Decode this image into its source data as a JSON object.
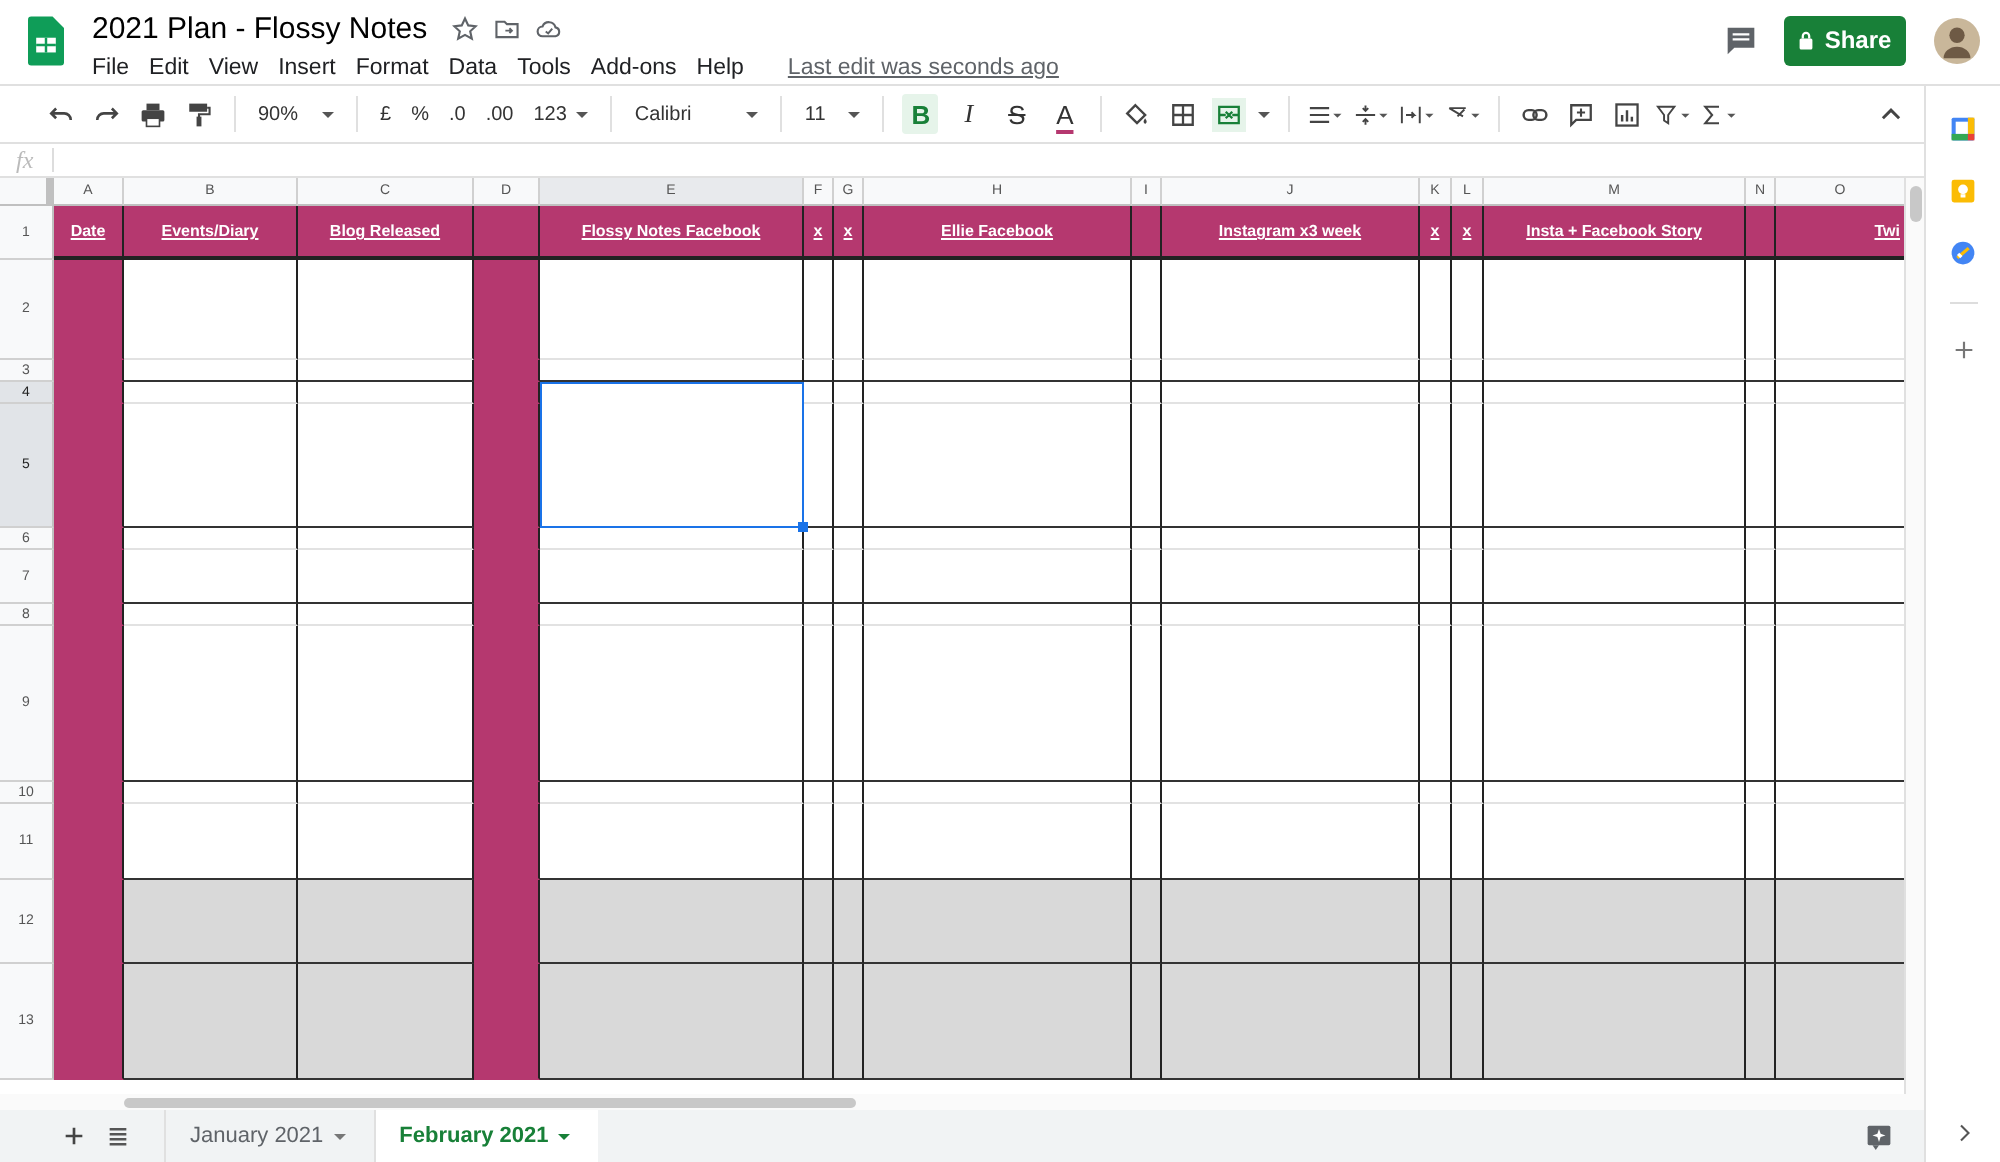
{
  "document": {
    "title": "2021 Plan - Flossy Notes"
  },
  "menu": [
    {
      "label": "File"
    },
    {
      "label": "Edit"
    },
    {
      "label": "View"
    },
    {
      "label": "Insert"
    },
    {
      "label": "Format"
    },
    {
      "label": "Data"
    },
    {
      "label": "Tools"
    },
    {
      "label": "Add-ons"
    },
    {
      "label": "Help"
    }
  ],
  "last_edit": "Last edit was seconds ago",
  "share_button": "Share",
  "toolbar": {
    "zoom": "90%",
    "currency": "£",
    "percent": "%",
    "decrease_decimals": ".0",
    "increase_decimals": ".00",
    "number_format": "123",
    "font": "Calibri",
    "font_size": "11",
    "bold": {
      "label": "B",
      "selected": true
    },
    "italic": {
      "label": "I",
      "selected": false
    },
    "strikethrough": {
      "label": "S",
      "selected": false
    },
    "text_color": {
      "label": "A"
    },
    "merge_cells": {
      "selected": true
    }
  },
  "formula_bar": {
    "label": "fx"
  },
  "header_row_number": "1",
  "columns": [
    {
      "letter": "A",
      "header": "Date",
      "filled": true,
      "selected": false
    },
    {
      "letter": "B",
      "header": "Events/Diary",
      "filled": false,
      "selected": false
    },
    {
      "letter": "C",
      "header": "Blog Released",
      "filled": false,
      "selected": false
    },
    {
      "letter": "D",
      "filled": true,
      "selected": false
    },
    {
      "letter": "E",
      "header": "Flossy Notes Facebook",
      "filled": false,
      "selected": true
    },
    {
      "letter": "F",
      "header": "x",
      "filled": false,
      "selected": false
    },
    {
      "letter": "G",
      "header": "x",
      "filled": false,
      "selected": false
    },
    {
      "letter": "H",
      "header": "Ellie Facebook",
      "filled": false,
      "selected": false
    },
    {
      "letter": "I",
      "filled": false,
      "selected": false
    },
    {
      "letter": "J",
      "header": "Instagram x3 week",
      "filled": false,
      "selected": false
    },
    {
      "letter": "K",
      "header": "x",
      "filled": false,
      "selected": false
    },
    {
      "letter": "L",
      "header": "x",
      "filled": false,
      "selected": false
    },
    {
      "letter": "M",
      "header": "Insta + Facebook Story",
      "filled": false,
      "selected": false
    },
    {
      "letter": "N",
      "filled": false,
      "selected": false
    },
    {
      "letter": "O",
      "header": "Twi",
      "filled": false,
      "selected": false
    }
  ],
  "rows": [
    {
      "number": "2",
      "shaded": false,
      "selected": false
    },
    {
      "number": "3",
      "shaded": false,
      "selected": false
    },
    {
      "number": "4",
      "shaded": false,
      "selected": true
    },
    {
      "number": "5",
      "shaded": false,
      "selected": true
    },
    {
      "number": "6",
      "shaded": false,
      "selected": false
    },
    {
      "number": "7",
      "shaded": false,
      "selected": false
    },
    {
      "number": "8",
      "shaded": false,
      "selected": false
    },
    {
      "number": "9",
      "shaded": false,
      "selected": false
    },
    {
      "number": "10",
      "shaded": false,
      "selected": false
    },
    {
      "number": "11",
      "shaded": false,
      "selected": false
    },
    {
      "number": "12",
      "shaded": true,
      "selected": false
    },
    {
      "number": "13",
      "shaded": true,
      "selected": false
    }
  ],
  "sheets": [
    {
      "name": "January 2021",
      "selected": false
    },
    {
      "name": "February 2021",
      "selected": true
    }
  ]
}
